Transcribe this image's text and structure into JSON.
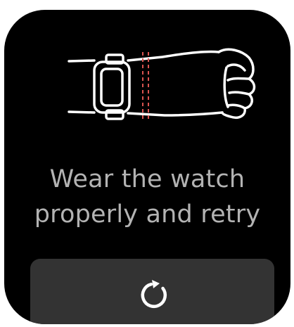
{
  "message": {
    "line1": "Wear the watch",
    "line2": "properly and retry"
  },
  "retry_button": {
    "icon": "refresh-icon"
  },
  "illustration": {
    "icon": "wrist-with-watch-icon"
  },
  "colors": {
    "background": "#000000",
    "text": "#b3b3b3",
    "button": "#333333",
    "accent": "#d9534f",
    "line": "#ffffff"
  }
}
